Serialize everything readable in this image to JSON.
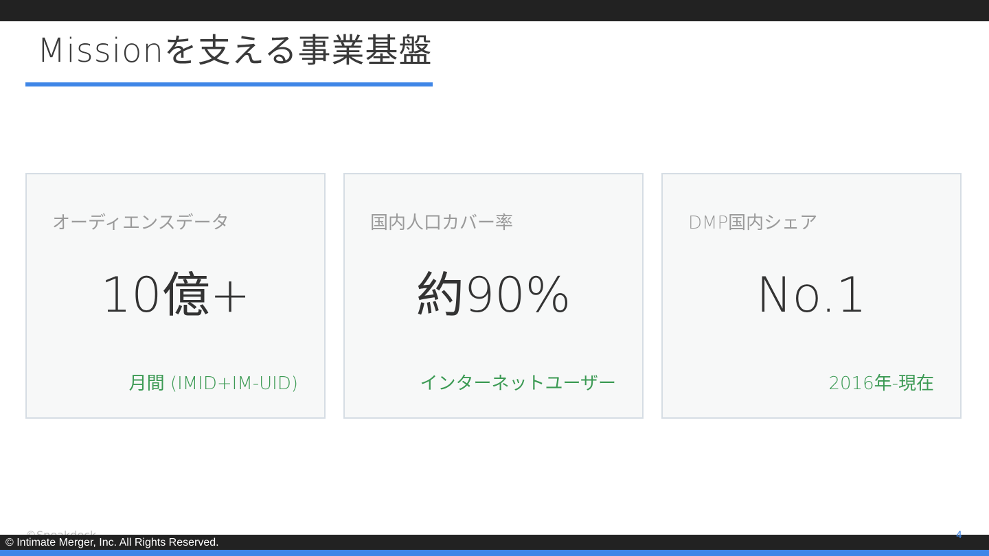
{
  "slide": {
    "title": "Missionを支える事業基盤",
    "ghost_text": "©Speakdeck",
    "copyright": "© Intimate Merger, Inc. All Rights Reserved.",
    "page_number": "4"
  },
  "cards": [
    {
      "label": "オーディエンスデータ",
      "value": "10億+",
      "note": "月間 (IMID+IM-UID)"
    },
    {
      "label": "国内人口カバー率",
      "value": "約90%",
      "note": "インターネットユーザー"
    },
    {
      "label": "DMP国内シェア",
      "value": "No.1",
      "note": "2016年-現在"
    }
  ],
  "colors": {
    "accent": "#3f86e7",
    "note_green": "#3c9a54",
    "card_bg": "#f7f8f8",
    "bar_dark": "#222222"
  }
}
